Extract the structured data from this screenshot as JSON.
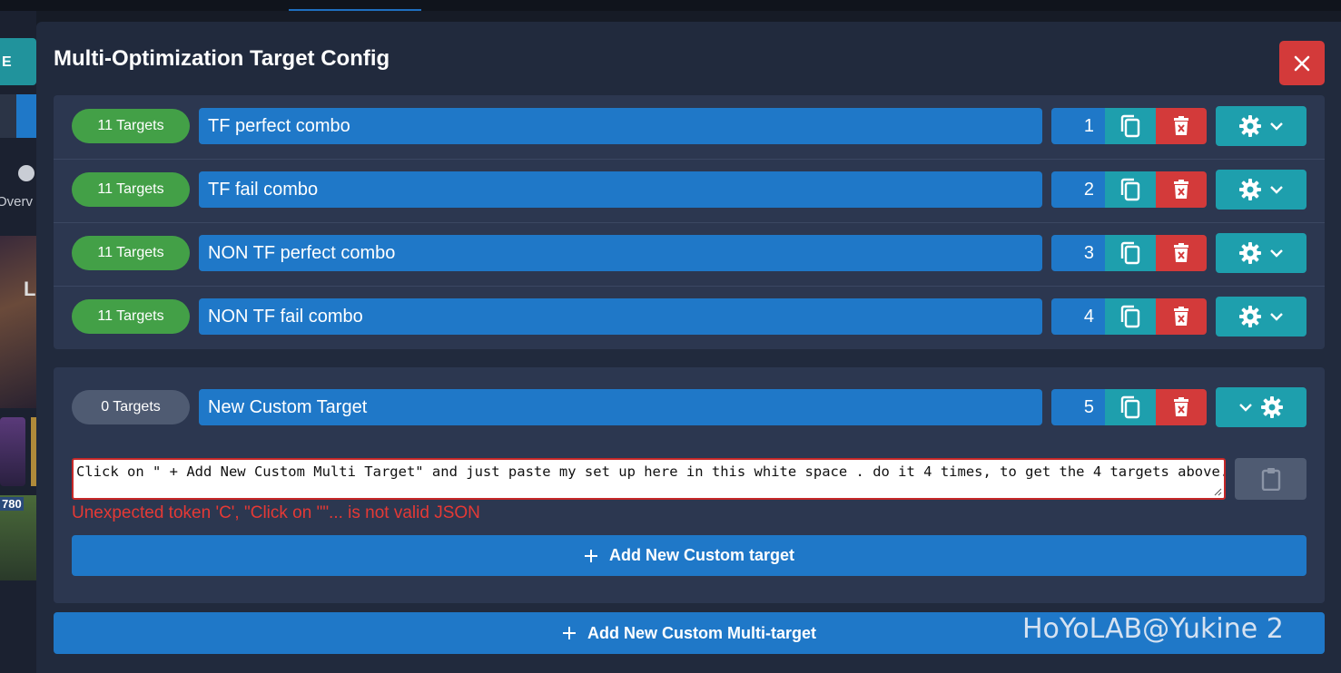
{
  "background": {
    "chip_text": "E",
    "nav_label": "Overv",
    "art_letter": "L",
    "badge_number": "780"
  },
  "modal": {
    "title": "Multi-Optimization Target Config"
  },
  "targets": [
    {
      "count_label": "11 Targets",
      "name": "TF perfect combo",
      "index": "1"
    },
    {
      "count_label": "11 Targets",
      "name": "TF fail combo",
      "index": "2"
    },
    {
      "count_label": "11 Targets",
      "name": "NON TF perfect combo",
      "index": "3"
    },
    {
      "count_label": "11 Targets",
      "name": "NON TF fail combo",
      "index": "4"
    }
  ],
  "custom_target": {
    "count_label": "0 Targets",
    "name": "New Custom Target",
    "index": "5",
    "json_value": "Click on \" + Add New Custom Multi Target\" and just paste my set up here in this white space . do it 4 times, to get the 4 targets above.",
    "error": "Unexpected token 'C', \"Click on \"\"... is not valid JSON",
    "add_target_label": "Add New Custom target"
  },
  "add_multi_target_label": "Add New Custom Multi-target",
  "watermark": "HoYoLAB@Yukine 2",
  "colors": {
    "modal_bg": "#212a3d",
    "group_bg": "#2c3750",
    "primary": "#1f78c8",
    "success": "#43a047",
    "info": "#1e9fad",
    "danger": "#d33a3a",
    "error_text": "#e53935"
  },
  "icons": {
    "close": "close-icon",
    "copy": "copy-icon",
    "delete": "trash-icon",
    "settings": "gear-icon",
    "expand": "chevron-down-icon",
    "paste": "clipboard-icon",
    "add": "plus-icon"
  }
}
